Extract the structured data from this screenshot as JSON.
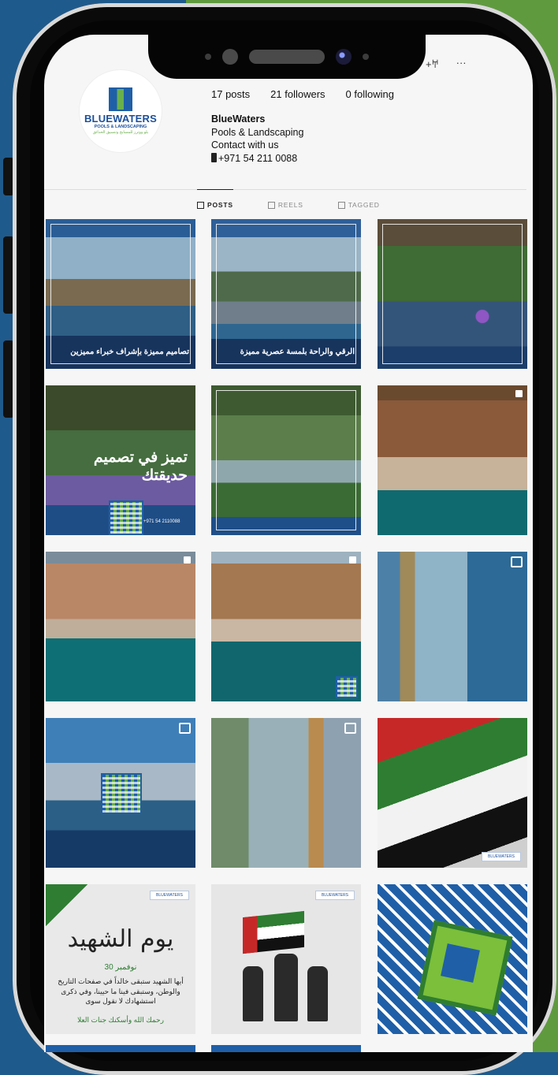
{
  "profile": {
    "avatar_brand": "BLUEWATERS",
    "avatar_sub": "POOLS & LANDSCAPING",
    "avatar_ar": "بلو ووترز للمسابح وتنسيق الحدائق",
    "stats": {
      "posts": "17 posts",
      "followers": "21 followers",
      "following": "0 following"
    },
    "name": "BlueWaters",
    "category": "Pools & Landscaping",
    "line3": "Contact with us",
    "phone": "+971 54 211 0088"
  },
  "top_icons": {
    "add_person": "+𐀀",
    "more": "···"
  },
  "tabs": [
    {
      "label": "POSTS",
      "active": true,
      "icon": "grid-icon"
    },
    {
      "label": "REELS",
      "active": false,
      "icon": "reels-icon"
    },
    {
      "label": "TAGGED",
      "active": false,
      "icon": "tag-icon"
    }
  ],
  "posts": [
    {
      "caption": "تصاميم مميزة بإشراف خبراء مميزين"
    },
    {
      "caption": "الرقي والراحة بلمسة عصرية مميزة"
    },
    {
      "caption": ""
    },
    {
      "caption": "تميز في تصميم حديقتك",
      "footer_phone": "+971 54 2110088"
    },
    {
      "caption": ""
    },
    {
      "caption": ""
    },
    {
      "caption": ""
    },
    {
      "caption": ""
    },
    {
      "caption": ""
    },
    {
      "caption": ""
    },
    {
      "caption": ""
    },
    {
      "caption": "",
      "brand": "BLUEWATERS"
    },
    {
      "title": "يوم الشهيد",
      "date": "30 نوفمبر",
      "body": "أيها الشهيد ستبقى خالداً في صفحات التاريخ والوطن، وستبقى فينا ما حيينا، وفي ذكرى استشهادك لا نقول سوى",
      "prayer": "رحمك الله وأسكنك جنات العلا",
      "brand": "BLUEWATERS"
    },
    {
      "brand": "BLUEWATERS"
    },
    {
      "caption": ""
    }
  ],
  "colors": {
    "brand_blue": "#1f5fa8",
    "brand_green": "#6ab04c",
    "bg_left": "#1f5a8c",
    "bg_right": "#5f9b3e"
  }
}
